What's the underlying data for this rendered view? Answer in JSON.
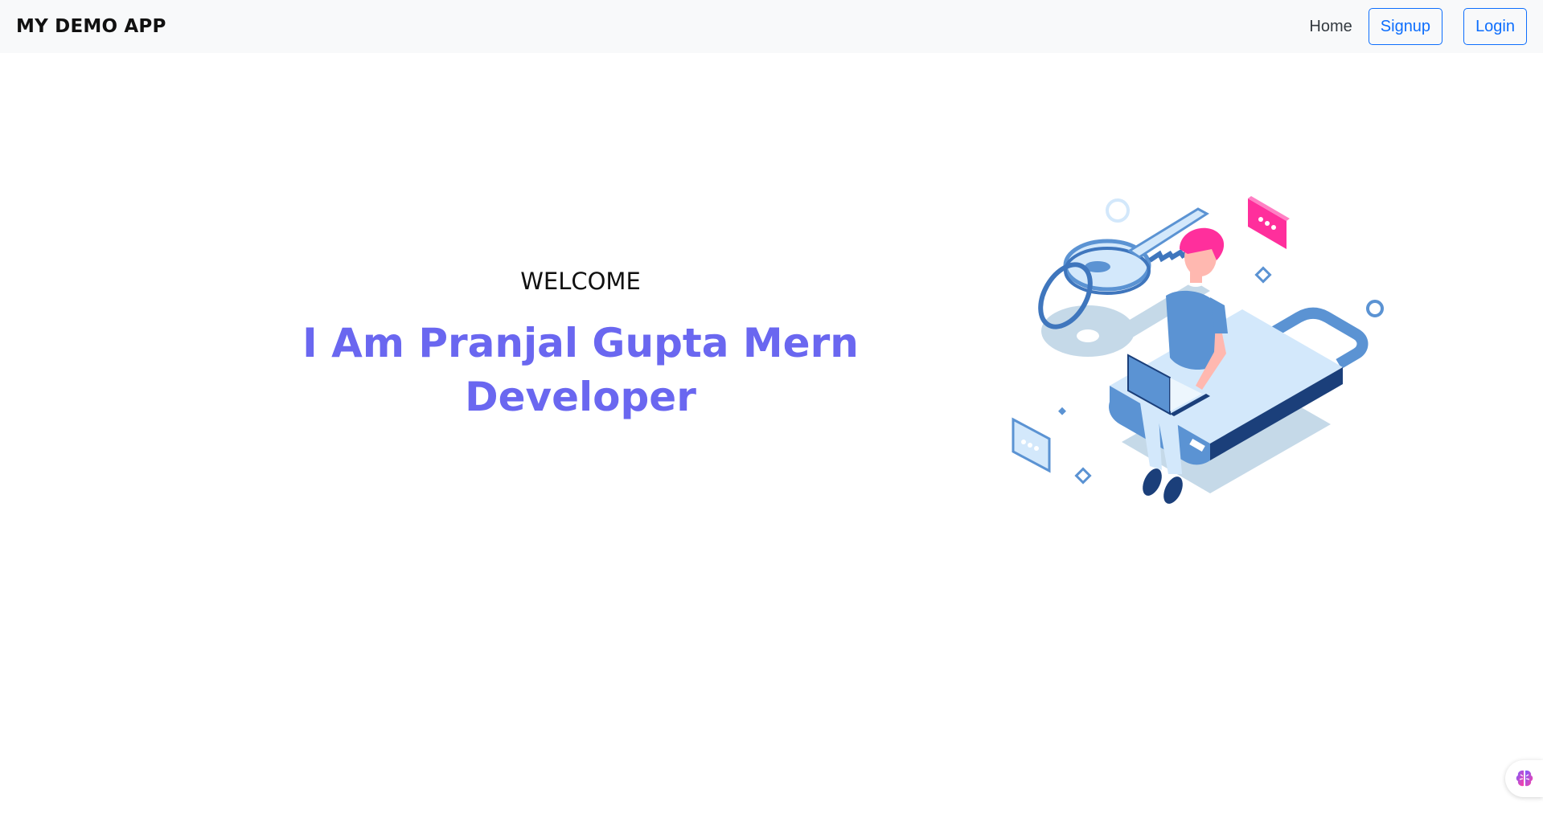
{
  "navbar": {
    "brand": "MY DEMO APP",
    "home_label": "Home",
    "signup_label": "Signup",
    "login_label": "Login"
  },
  "hero": {
    "welcome": "WELCOME",
    "headline": "I Am Pranjal Gupta Mern Developer"
  },
  "illustration": {
    "icon": "person-laptop-key-illustration",
    "chat_bubble_dots": "•••"
  },
  "colors": {
    "accent": "#0d6efd",
    "headline": "#6a67f0",
    "navbar_bg": "#f8f9fa",
    "illustration_blue": "#5b93d3",
    "illustration_light": "#d3e8fb",
    "illustration_navy": "#1b3f7a",
    "illustration_pink": "#ff2f9c"
  }
}
